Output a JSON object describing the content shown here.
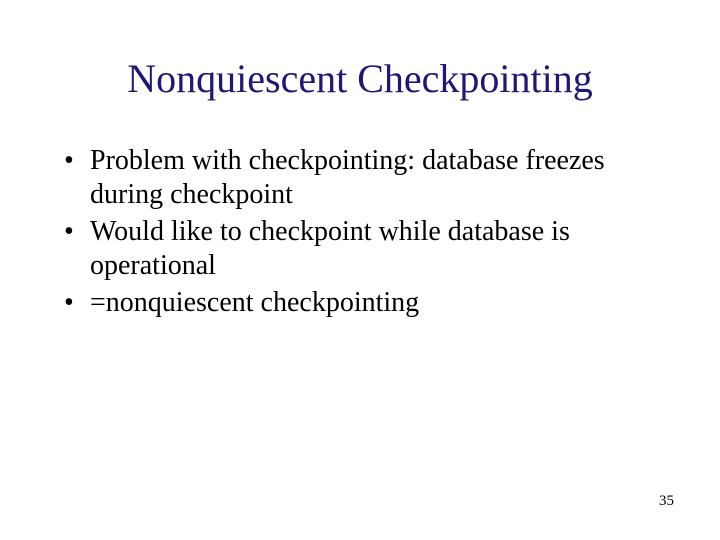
{
  "title": "Nonquiescent Checkpointing",
  "bullets": [
    "Problem with checkpointing: database freezes during checkpoint",
    "Would like to checkpoint while database is operational",
    "=nonquiescent checkpointing"
  ],
  "page_number": "35"
}
